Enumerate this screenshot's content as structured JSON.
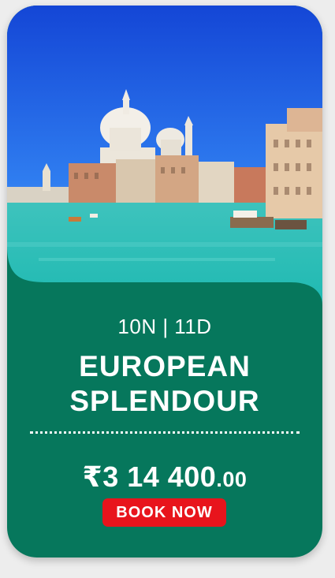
{
  "card": {
    "image_alt": "Venice Grand Canal with Santa Maria della Salute",
    "duration": "10N | 11D",
    "title_line1": "EUROPEAN",
    "title_line2": "SPLENDOUR",
    "price_currency": "₹",
    "price_main": "3 14 400",
    "price_decimal": ".00",
    "book_label": "BOOK NOW"
  },
  "colors": {
    "card_green": "#06775c",
    "button_red": "#e8141c",
    "page_bg": "#ededed"
  }
}
